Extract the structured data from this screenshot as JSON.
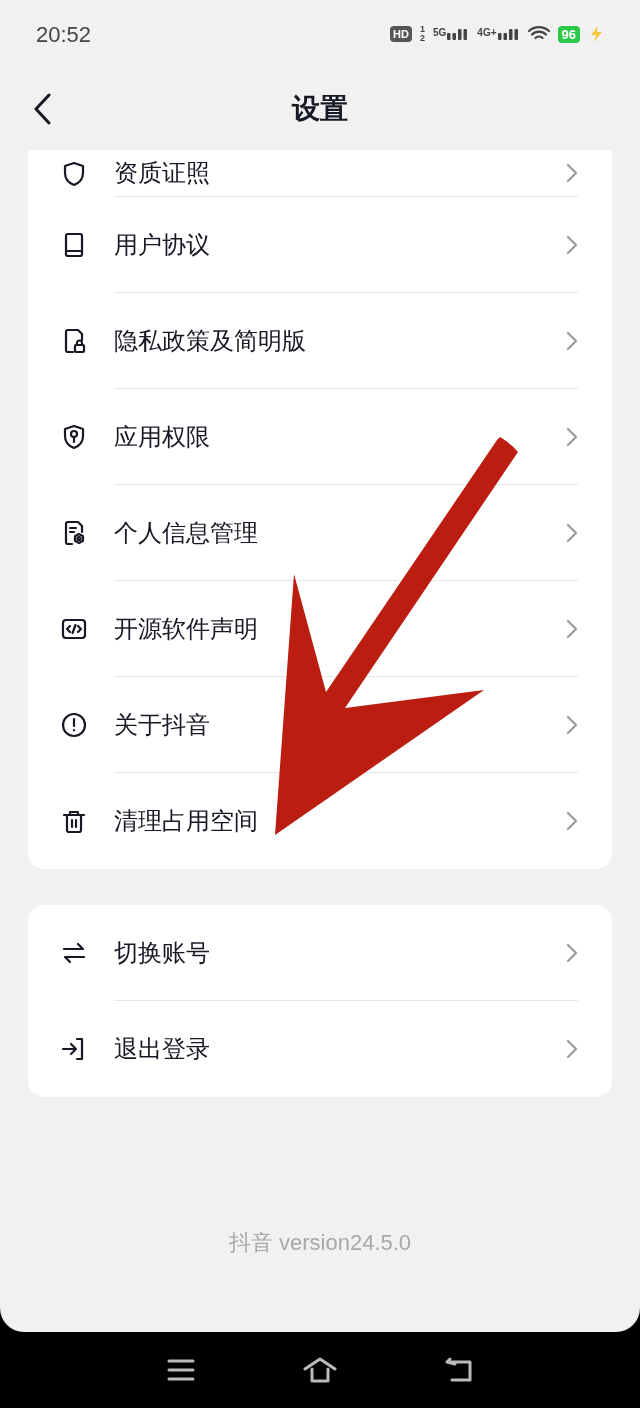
{
  "status_bar": {
    "time": "20:52",
    "hd": {
      "label": "HD",
      "sims": [
        "1",
        "2"
      ]
    },
    "networks": [
      "5G",
      "4G+"
    ],
    "battery": "96"
  },
  "header": {
    "title": "设置"
  },
  "groups": [
    {
      "items": [
        {
          "label": "资质证照"
        },
        {
          "label": "用户协议"
        },
        {
          "label": "隐私政策及简明版"
        },
        {
          "label": "应用权限"
        },
        {
          "label": "个人信息管理"
        },
        {
          "label": "开源软件声明"
        },
        {
          "label": "关于抖音"
        },
        {
          "label": "清理占用空间"
        }
      ]
    },
    {
      "items": [
        {
          "label": "切换账号"
        },
        {
          "label": "退出登录"
        }
      ]
    }
  ],
  "version": "抖音 version24.5.0"
}
